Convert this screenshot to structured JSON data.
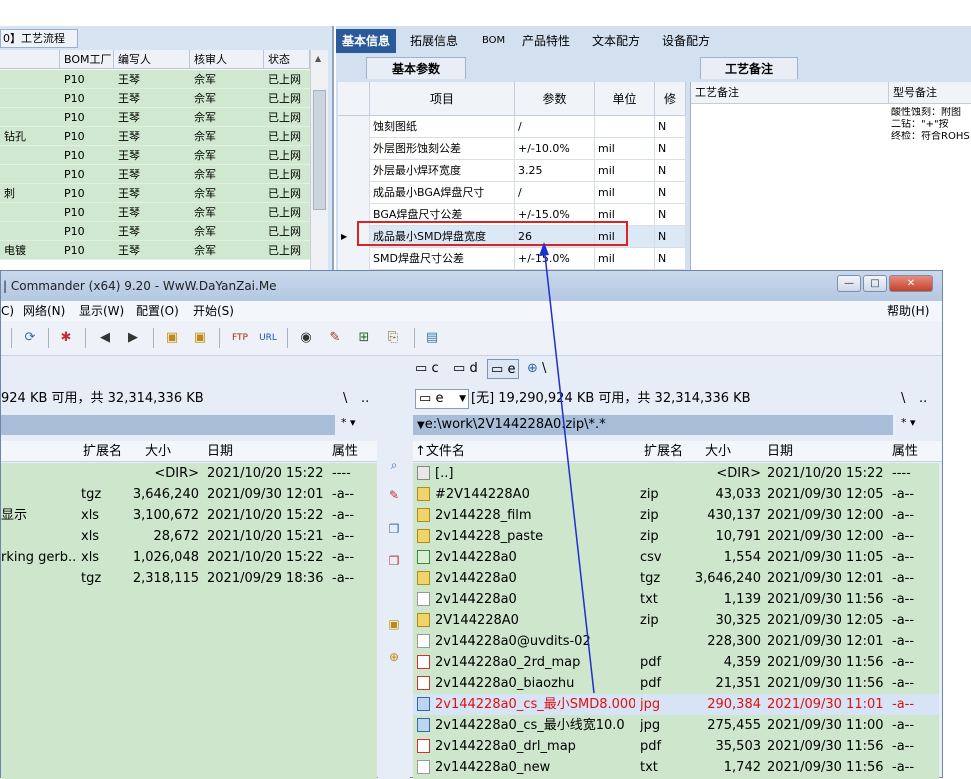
{
  "bg_app": {
    "left_tab": "0】工艺流程",
    "left_headers": [
      "BOM工厂",
      "编写人",
      "核审人",
      "状态"
    ],
    "left_rows": [
      {
        "c0": "",
        "c1": "P10",
        "c2": "王琴",
        "c3": "佘军",
        "c4": "已上网"
      },
      {
        "c0": "",
        "c1": "P10",
        "c2": "王琴",
        "c3": "佘军",
        "c4": "已上网"
      },
      {
        "c0": "",
        "c1": "P10",
        "c2": "王琴",
        "c3": "佘军",
        "c4": "已上网"
      },
      {
        "c0": "钻孔",
        "c1": "P10",
        "c2": "王琴",
        "c3": "佘军",
        "c4": "已上网"
      },
      {
        "c0": "",
        "c1": "P10",
        "c2": "王琴",
        "c3": "佘军",
        "c4": "已上网"
      },
      {
        "c0": "",
        "c1": "P10",
        "c2": "王琴",
        "c3": "佘军",
        "c4": "已上网"
      },
      {
        "c0": "刺",
        "c1": "P10",
        "c2": "王琴",
        "c3": "佘军",
        "c4": "已上网"
      },
      {
        "c0": "",
        "c1": "P10",
        "c2": "王琴",
        "c3": "佘军",
        "c4": "已上网"
      },
      {
        "c0": "",
        "c1": "P10",
        "c2": "王琴",
        "c3": "佘军",
        "c4": "已上网"
      },
      {
        "c0": "电镀",
        "c1": "P10",
        "c2": "王琴",
        "c3": "佘军",
        "c4": "已上网"
      }
    ],
    "right_tabs": [
      "基本信息",
      "拓展信息",
      "BOM",
      "产品特性",
      "文本配方",
      "设备配方"
    ],
    "basic_tab": "基本参数",
    "remark_tab": "工艺备注",
    "param_headers": [
      "项目",
      "参数",
      "单位",
      "修"
    ],
    "param_rows": [
      {
        "item": "蚀刻图纸",
        "param": "/",
        "unit": "",
        "flag": "N"
      },
      {
        "item": "外层图形蚀刻公差",
        "param": "+/-10.0%",
        "unit": "mil",
        "flag": "N"
      },
      {
        "item": "外层最小焊环宽度",
        "param": "3.25",
        "unit": "mil",
        "flag": "N"
      },
      {
        "item": "成品最小BGA焊盘尺寸",
        "param": "/",
        "unit": "mil",
        "flag": "N"
      },
      {
        "item": "BGA焊盘尺寸公差",
        "param": "+/-15.0%",
        "unit": "mil",
        "flag": "N"
      },
      {
        "item": "成品最小SMD焊盘宽度",
        "param": "26",
        "unit": "mil",
        "flag": "N"
      },
      {
        "item": "SMD焊盘尺寸公差",
        "param": "+/-15.0%",
        "unit": "mil",
        "flag": "N"
      }
    ],
    "remark_headers": [
      "工艺备注",
      "型号备注"
    ],
    "remark_text": [
      "酸性蚀刻：附图",
      "二钻：\"+\"按",
      "终检：符合ROHS"
    ]
  },
  "tc": {
    "title": "| Commander (x64) 9.20 - WwW.DaYanZai.Me",
    "menu": [
      "C)",
      "网络(N)",
      "显示(W)",
      "配置(O)",
      "开始(S)"
    ],
    "help": "帮助(H)",
    "drives": [
      "c",
      "d",
      "e",
      "\\"
    ],
    "left_free": "924 KB 可用，共 32,314,336 KB",
    "left_path_btns": [
      "\\",
      ".."
    ],
    "left_cols": [
      "扩展名",
      "大小",
      "日期",
      "属性"
    ],
    "left_files": [
      {
        "name": "",
        "ext": "",
        "size": "<DIR>",
        "date": "2021/10/20 15:22",
        "attr": "----"
      },
      {
        "name": "",
        "ext": "tgz",
        "size": "3,646,240",
        "date": "2021/09/30 12:01",
        "attr": "-a--"
      },
      {
        "name": "显示",
        "ext": "xls",
        "size": "3,100,672",
        "date": "2021/10/20 15:22",
        "attr": "-a--"
      },
      {
        "name": "",
        "ext": "xls",
        "size": "28,672",
        "date": "2021/10/20 15:21",
        "attr": "-a--"
      },
      {
        "name": "rking gerb..",
        "ext": "xls",
        "size": "1,026,048",
        "date": "2021/10/20 15:22",
        "attr": "-a--"
      },
      {
        "name": "",
        "ext": "tgz",
        "size": "2,318,115",
        "date": "2021/09/29 18:36",
        "attr": "-a--"
      }
    ],
    "right_drive": "e",
    "right_free": "[无]  19,290,924 KB 可用，共 32,314,336 KB",
    "right_path": "e:\\work\\2V144228A0.zip\\*.*",
    "right_cols": [
      "↑文件名",
      "扩展名",
      "大小",
      "日期",
      "属性"
    ],
    "right_files": [
      {
        "name": "[..]",
        "ext": "",
        "size": "<DIR>",
        "date": "2021/10/20 15:22",
        "attr": "----",
        "icon": "up"
      },
      {
        "name": "#2V144228A0",
        "ext": "zip",
        "size": "43,033",
        "date": "2021/09/30 12:05",
        "attr": "-a--",
        "icon": "zip"
      },
      {
        "name": "2v144228_film",
        "ext": "zip",
        "size": "430,137",
        "date": "2021/09/30 12:00",
        "attr": "-a--",
        "icon": "zip"
      },
      {
        "name": "2v144228_paste",
        "ext": "zip",
        "size": "10,791",
        "date": "2021/09/30 12:00",
        "attr": "-a--",
        "icon": "zip"
      },
      {
        "name": "2v144228a0",
        "ext": "csv",
        "size": "1,554",
        "date": "2021/09/30 11:05",
        "attr": "-a--",
        "icon": "csv"
      },
      {
        "name": "2v144228a0",
        "ext": "tgz",
        "size": "3,646,240",
        "date": "2021/09/30 12:01",
        "attr": "-a--",
        "icon": "zip"
      },
      {
        "name": "2v144228a0",
        "ext": "txt",
        "size": "1,139",
        "date": "2021/09/30 11:56",
        "attr": "-a--",
        "icon": "txt"
      },
      {
        "name": "2V144228A0",
        "ext": "zip",
        "size": "30,325",
        "date": "2021/09/30 12:05",
        "attr": "-a--",
        "icon": "zip"
      },
      {
        "name": "2v144228a0@uvdits-02",
        "ext": "",
        "size": "228,300",
        "date": "2021/09/30 12:01",
        "attr": "-a--",
        "icon": "txt"
      },
      {
        "name": "2v144228a0_2rd_map",
        "ext": "pdf",
        "size": "4,359",
        "date": "2021/09/30 11:56",
        "attr": "-a--",
        "icon": "pdf"
      },
      {
        "name": "2v144228a0_biaozhu",
        "ext": "pdf",
        "size": "21,351",
        "date": "2021/09/30 11:56",
        "attr": "-a--",
        "icon": "pdf"
      },
      {
        "name": "2v144228a0_cs_最小SMD8.000",
        "ext": "jpg",
        "size": "290,384",
        "date": "2021/09/30 11:01",
        "attr": "-a--",
        "icon": "jpg",
        "sel": true
      },
      {
        "name": "2v144228a0_cs_最小线宽10.0",
        "ext": "jpg",
        "size": "275,455",
        "date": "2021/09/30 11:00",
        "attr": "-a--",
        "icon": "jpg"
      },
      {
        "name": "2v144228a0_drl_map",
        "ext": "pdf",
        "size": "35,503",
        "date": "2021/09/30 11:56",
        "attr": "-a--",
        "icon": "pdf"
      },
      {
        "name": "2v144228a0_new",
        "ext": "txt",
        "size": "1,742",
        "date": "2021/09/30 11:56",
        "attr": "-a--",
        "icon": "txt"
      }
    ]
  },
  "colors": {
    "selected_text": "#e01010",
    "list_bg": "#cde6cc",
    "arrow": "#1f2fd0",
    "highlight": "#d22222"
  }
}
